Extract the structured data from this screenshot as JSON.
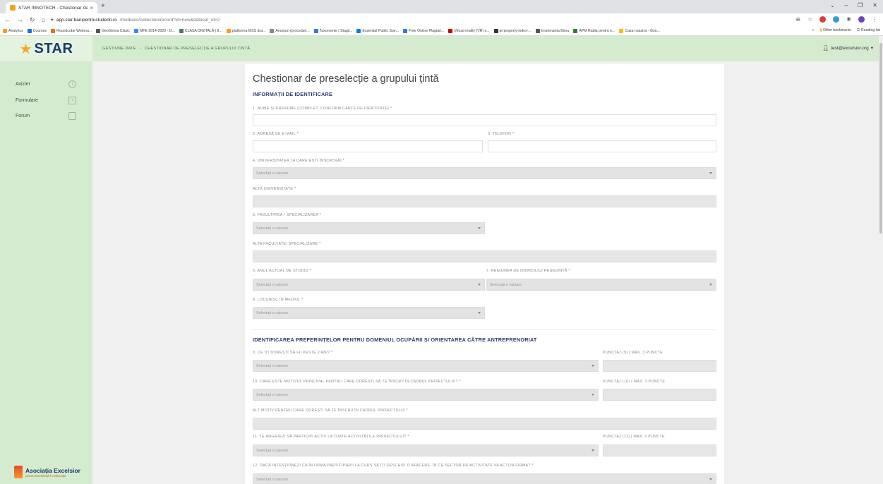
{
  "browser": {
    "tab_title": "STAR INNOTECH - Chestionar de",
    "tab_close": "×",
    "new_tab": "+",
    "url_host": "app.star.banipentrustudenti.ro",
    "url_path": "/modules/collection/record?id=new&dataset_id=2",
    "bookmarks": [
      "Analytics",
      "Courses",
      "Roundcube Webma...",
      "GeoGebra Clasic",
      "MFE 2014-2020 - D...",
      "CLASA DIGITALĂ | 8...",
      "platforma MSS dra...",
      "Anunțuri (proceduri...",
      "Taxonomie | Stagii...",
      "Essential Public Spe...",
      "Free Online Plagiari...",
      "Virtual reality (VR) s...",
      "at-property-index-...",
      "Imprimanta Birou",
      "APM Rabla pentru e...",
      "Casa noastra - Goo..."
    ],
    "bookmarks_more": "»",
    "other_bookmarks": "Other bookmarks",
    "reading_list": "Reading list",
    "colors": {
      "bookmark_icons": [
        "#f4a019",
        "#1a73e8",
        "#e8710a",
        "#555555",
        "#4285f4",
        "#4a7c59",
        "#f4a019",
        "#888888",
        "#3c78d8",
        "#1a73e8",
        "#3c78d8",
        "#cc0000",
        "#333333",
        "#555555",
        "#2e7d32",
        "#fbbc04"
      ]
    }
  },
  "header": {
    "logo_text": "STAR",
    "breadcrumb": [
      "GESTIUNE DATE",
      "CHESTIONAR DE PRESELECȚIE A GRUPULUI ȚINTĂ"
    ],
    "breadcrumb_sep": "›",
    "user_email": "test@excelsior.org"
  },
  "sidebar": {
    "items": [
      {
        "label": "Avizier",
        "icon": "info-circle-icon"
      },
      {
        "label": "Formulare",
        "icon": "plus-square-icon"
      },
      {
        "label": "Forum",
        "icon": "chat-bubble-icon"
      }
    ],
    "footer_title": "Asociația Excelsior",
    "footer_subtitle": "pentru Excelență în Educație"
  },
  "form": {
    "title": "Chestionar de preselecție a grupului țintă",
    "section1": "INFORMAȚII DE IDENTIFICARE",
    "section2": "IDENTIFICAREA PREFERINȚELOR PENTRU DOMENIUL OCUPĂRII ȘI ORIENTAREA CĂTRE ANTREPRENORIAT",
    "placeholder": "Selectați o valoare",
    "required_mark": "*",
    "labels": {
      "q1": "1. NUME ȘI PRENUME (COMPLET, CONFORM CARTE DE IDENTITATE)",
      "q2": "2. ADRESĂ DE E-MAIL",
      "q3": "3. TELEFON",
      "q4": "4. UNIVERSITATEA LA CARE EȘTI ÎNSCRIS(Ă)",
      "q4b": "ALTĂ UNIVERSITATE",
      "q5": "5. FACULTATEA / SPECIALIZAREA",
      "q5b": "ALTA FACULTATE/ SPECIALIZARE",
      "q6": "6. ANUL ACTUAL DE STUDIU",
      "q7": "7. REGIUNEA DE DOMICILIU/ REȘEDINȚĂ",
      "q8": "8. LOCUIESC ÎN MEDIUL",
      "q9": "9. CE ÎȚI DOREȘTI SĂ FII PESTE 2 ANI?",
      "q9p": "PUNCTAJ (9) | MAX. 3 PUNCTE",
      "q10": "10. CARE ESTE MOTIVUL PRINCIPAL PENTRU CARE DOREȘTI SĂ TE ÎNSCRII ÎN CADRUL PROIECTULUI?",
      "q10p": "PUNCTAJ (10) | MAX. 3 PUNCTE",
      "q10b": "ALT MOTIV PENTRU CARE DOREȘTI SĂ TE ÎNSCRII ÎN CADRUL PROIECTULUI",
      "q11": "11. TE ANGAJEZI SĂ PARTICIPI ACTIV LA TOATE ACTIVITĂȚILE PROIECTULUI?",
      "q11p": "PUNCTAJ (11) | MAX. 3 PUNCTE",
      "q12": "12. DACĂ INTENȚIONEZI CA ÎN URMA PARTICIPĂRII LA CURS SĂ ÎȚI DESCHIZI O AFACERE, ÎN CE SECTOR DE ACTIVITATE VA ACTIVA FIRMA?"
    }
  },
  "colors": {
    "accent_green": "#d4ebcf",
    "title_blue": "#2e3a70",
    "required_red": "#d9534f",
    "logo_star": "#f5a623",
    "logo_blue": "#1b3a6b"
  }
}
